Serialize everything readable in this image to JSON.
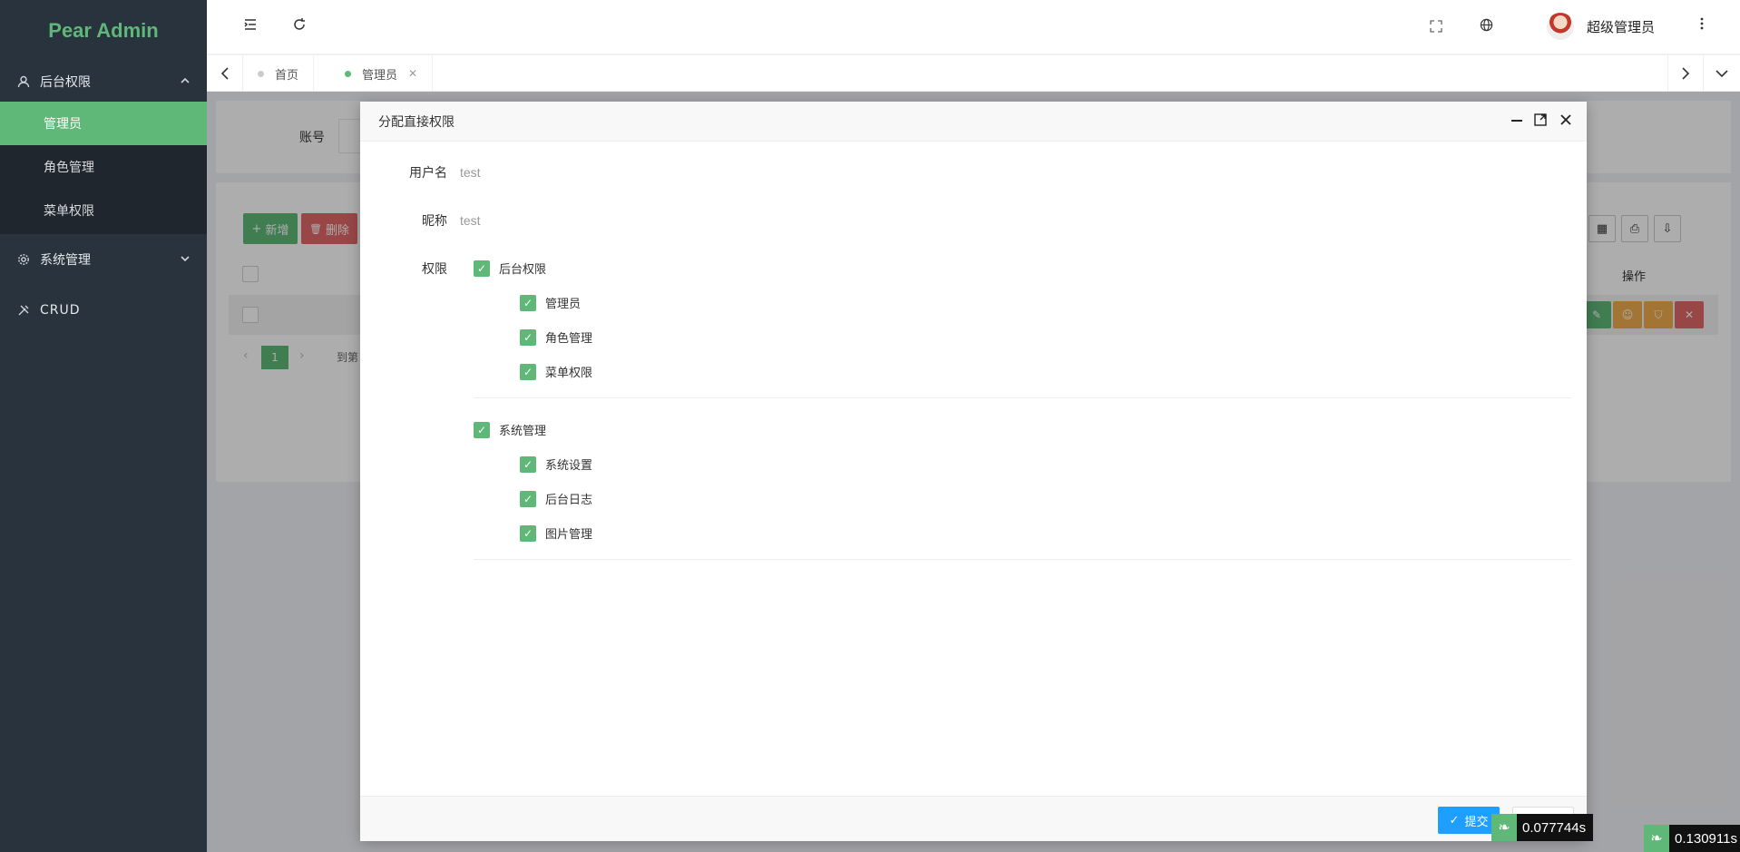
{
  "sidebar": {
    "logo": "Pear Admin",
    "groups": [
      {
        "label": "后台权限",
        "items": [
          "管理员",
          "角色管理",
          "菜单权限"
        ]
      },
      {
        "label": "系统管理"
      },
      {
        "label": "CRUD"
      }
    ]
  },
  "header": {
    "user_name": "超级管理员"
  },
  "tabs": [
    {
      "label": "首页"
    },
    {
      "label": "管理员"
    }
  ],
  "content": {
    "search_label": "账号",
    "add_button": "新增",
    "delete_button": "删除",
    "table_header_ops": "操作",
    "pager_page": "1",
    "pager_goto": "到第"
  },
  "modal": {
    "title": "分配直接权限",
    "username_label": "用户名",
    "username_value": "test",
    "nickname_label": "昵称",
    "nickname_value": "test",
    "perm_label": "权限",
    "groups": [
      {
        "label": "后台权限",
        "children": [
          "管理员",
          "角色管理",
          "菜单权限"
        ]
      },
      {
        "label": "系统管理",
        "children": [
          "系统设置",
          "后台日志",
          "图片管理"
        ]
      }
    ],
    "submit_label": "提交"
  },
  "timings": [
    "0.077744s",
    "0.130911s"
  ],
  "colors": {
    "accent": "#5fb878",
    "sidebar_bg": "#28333e",
    "danger": "#e06767",
    "warm": "#f0ad4e",
    "primary_blue": "#1e9fff"
  }
}
